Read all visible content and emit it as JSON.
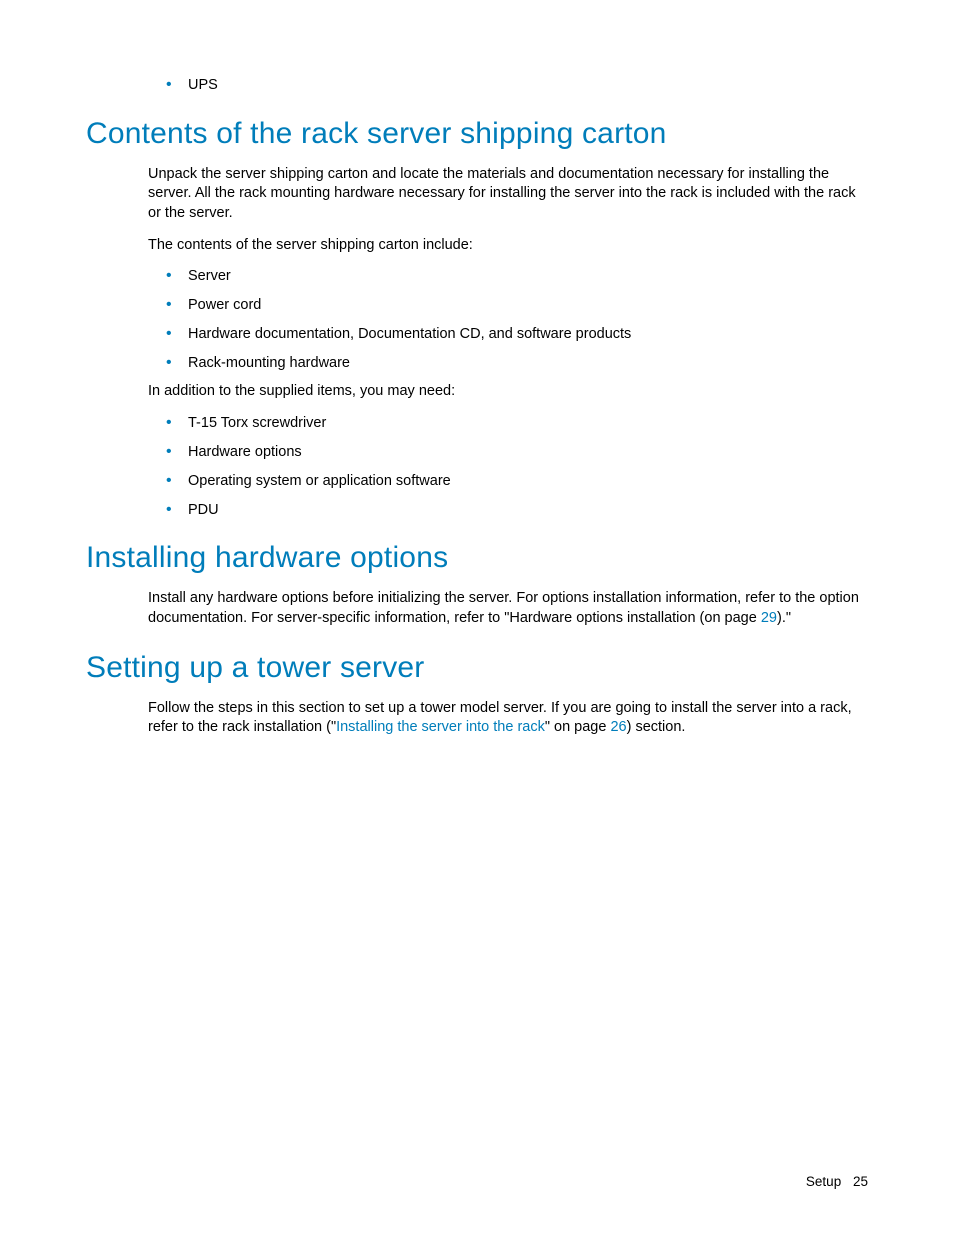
{
  "top_bullet": "UPS",
  "section1": {
    "heading": "Contents of the rack server shipping carton",
    "p1": "Unpack the server shipping carton and locate the materials and documentation necessary for installing the server. All the rack mounting hardware necessary for installing the server into the rack is included with the rack or the server.",
    "p2": "The contents of the server shipping carton include:",
    "listA": {
      "0": "Server",
      "1": "Power cord",
      "2": "Hardware documentation, Documentation CD, and software products",
      "3": "Rack-mounting hardware"
    },
    "p3": "In addition to the supplied items, you may need:",
    "listB": {
      "0": "T-15 Torx screwdriver",
      "1": "Hardware options",
      "2": "Operating system or application software",
      "3": "PDU"
    }
  },
  "section2": {
    "heading": "Installing hardware options",
    "p1_a": "Install any hardware options before initializing the server. For options installation information, refer to the option documentation. For server-specific information, refer to \"Hardware options installation (on page ",
    "p1_link": "29",
    "p1_b": ").\""
  },
  "section3": {
    "heading": "Setting up a tower server",
    "p1_a": "Follow the steps in this section to set up a tower model server. If you are going to install the server into a rack, refer to the rack installation (\"",
    "p1_link1": "Installing the server into the rack",
    "p1_b": "\" on page ",
    "p1_link2": "26",
    "p1_c": ") section."
  },
  "footer": {
    "label": "Setup",
    "page": "25"
  }
}
